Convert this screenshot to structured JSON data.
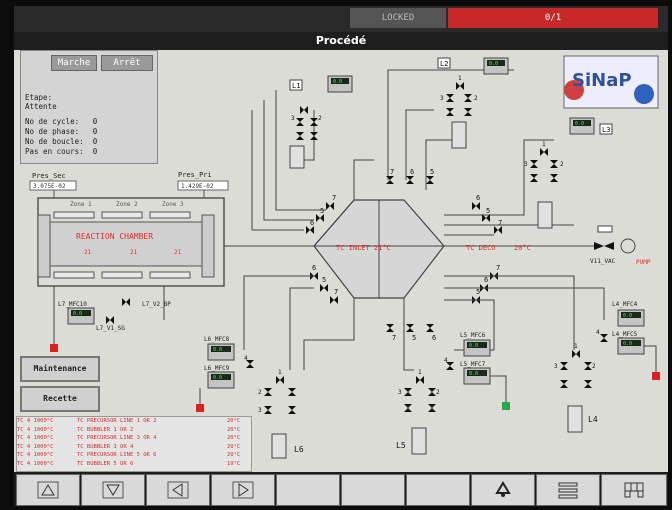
{
  "header": {
    "locked_label": "LOCKED",
    "alarm_text": "0/1",
    "title": "Procédé"
  },
  "status_panel": {
    "marche_label": "Marche",
    "arret_label": "Arrêt",
    "etape_label": "Etape:",
    "etape_value": "Attente",
    "lines": [
      {
        "label": "No de cycle:",
        "value": "0"
      },
      {
        "label": "No de phase:",
        "value": "0"
      },
      {
        "label": "No de boucle:",
        "value": "0"
      },
      {
        "label": "Pas en cours:",
        "value": "0"
      }
    ]
  },
  "chamber": {
    "pres_sec_label": "Pres_Sec",
    "pres_sec_value": "3.075E-02",
    "pres_pri_label": "Pres_Pri",
    "pres_pri_value": "1.429E-02",
    "zones": [
      "Zone 1",
      "Zone 2",
      "Zone 3"
    ],
    "title": "REACTION CHAMBER",
    "zone_temps": [
      "21",
      "21",
      "21"
    ]
  },
  "process": {
    "tc_inlet": "TC INLET  21°C",
    "tc_deco": "TC DECO",
    "tc_deco_temp": "20°C",
    "vac_valve": "V11_VAC",
    "pump_label": "PUMP",
    "l7_mfc": "L7_MFC10",
    "l7_v2": "L7_V2_BP",
    "l7_v1": "L7_V1_SG",
    "l6_mfc8": "L6_MFC8",
    "l6_mfc9": "L6_MFC9",
    "l5_mfc6": "L5_MFC6",
    "l5_mfc7": "L5_MFC7",
    "l4_mfc4": "L4_MFC4",
    "l4_mfc5": "L4_MFC5",
    "mfc_value": "0.0",
    "line_labels": [
      "L1",
      "L2",
      "L3",
      "L4",
      "L5",
      "L6"
    ],
    "logo_text": "SiNaP"
  },
  "side_buttons": {
    "maintenance": "Maintenance",
    "recette": "Recette"
  },
  "alarms": [
    {
      "left": "TC 4 1000°C",
      "mid": "TC PRECURSOR LINE 1 OR 2",
      "right": "20°C"
    },
    {
      "left": "TC 4 1000°C",
      "mid": "TC BUBBLER 1 OR 2",
      "right": "20°C"
    },
    {
      "left": "TC 4 1000°C",
      "mid": "TC PRECURSOR LINE 3 OR 4",
      "right": "20°C"
    },
    {
      "left": "TC 4 1000°C",
      "mid": "TC BUBBLER 3 OR 4",
      "right": "20°C"
    },
    {
      "left": "TC 4 1000°C",
      "mid": "TC PRECURSOR LINE 5 OR 6",
      "right": "20°C"
    },
    {
      "left": "TC 4 1000°C",
      "mid": "TC BUBBLER 5 OR 6",
      "right": "19°C"
    }
  ],
  "colors": {
    "alarm_red": "#c82828",
    "indicator_red": "#e02020",
    "indicator_green": "#2aa84a",
    "screen_bg": "#dcdcd6"
  },
  "bottom_icons": [
    "triangle-up-icon",
    "triangle-down-icon",
    "triangle-left-icon",
    "triangle-right-icon",
    "blank",
    "blank",
    "blank",
    "recycle-icon",
    "list-icon",
    "grid-icon"
  ]
}
